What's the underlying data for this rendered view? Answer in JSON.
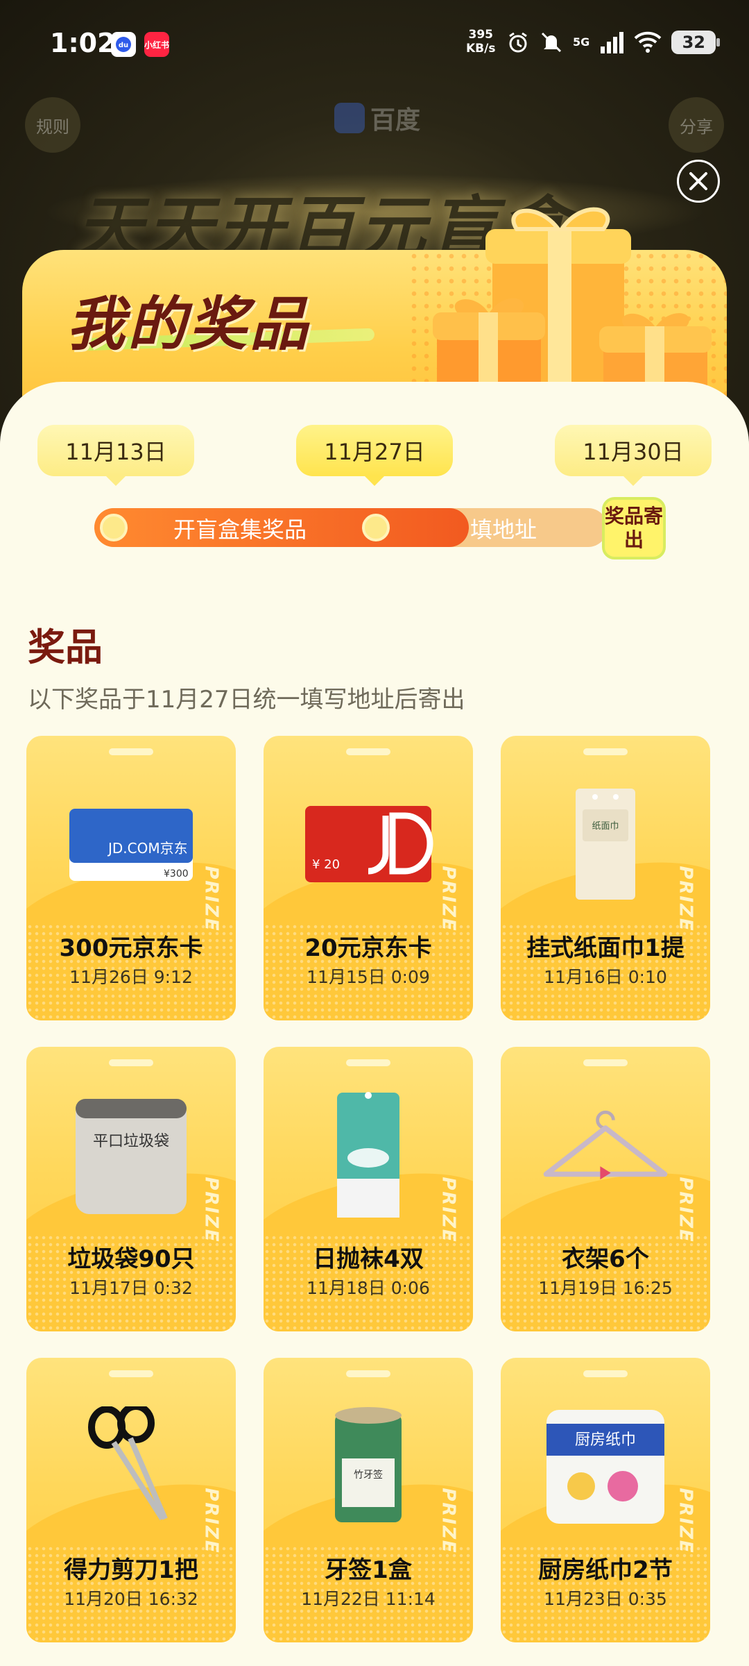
{
  "status_bar": {
    "time": "1:02",
    "xhs_badge": "小红书",
    "net_speed_value": "395",
    "net_speed_unit": "KB/s",
    "network": "5G",
    "battery": "32"
  },
  "header": {
    "rules_label": "规则",
    "share_label": "分享",
    "brand": "百度",
    "background_title": "天天开百元盲盒"
  },
  "banner": {
    "title": "我的奖品"
  },
  "timeline": {
    "dates": [
      "11月13日",
      "11月27日",
      "11月30日"
    ],
    "active_index": 1,
    "steps": [
      "开盲盒集奖品",
      "填地址"
    ],
    "final_step": "奖品寄出"
  },
  "section": {
    "title": "奖品",
    "subtitle": "以下奖品于11月27日统一填写地址后寄出"
  },
  "prize_tag": "PRIZE",
  "prizes": [
    {
      "name": "300元京东卡",
      "time": "11月26日 9:12",
      "icon": "jd-card-blue-icon"
    },
    {
      "name": "20元京东卡",
      "time": "11月15日 0:09",
      "icon": "jd-card-red-icon"
    },
    {
      "name": "挂式纸面巾1提",
      "time": "11月16日 0:10",
      "icon": "tissue-pack-icon"
    },
    {
      "name": "垃圾袋90只",
      "time": "11月17日 0:32",
      "icon": "trash-bag-icon"
    },
    {
      "name": "日抛袜4双",
      "time": "11月18日 0:06",
      "icon": "socks-pack-icon"
    },
    {
      "name": "衣架6个",
      "time": "11月19日 16:25",
      "icon": "hanger-icon"
    },
    {
      "name": "得力剪刀1把",
      "time": "11月20日 16:32",
      "icon": "scissors-icon"
    },
    {
      "name": "牙签1盒",
      "time": "11月22日 11:14",
      "icon": "toothpick-box-icon"
    },
    {
      "name": "厨房纸巾2节",
      "time": "11月23日 0:35",
      "icon": "kitchen-towel-icon"
    }
  ],
  "colors": {
    "accent_orange": "#f25a20",
    "card_yellow": "#ffd75a",
    "title_brown": "#7a1a0e"
  }
}
